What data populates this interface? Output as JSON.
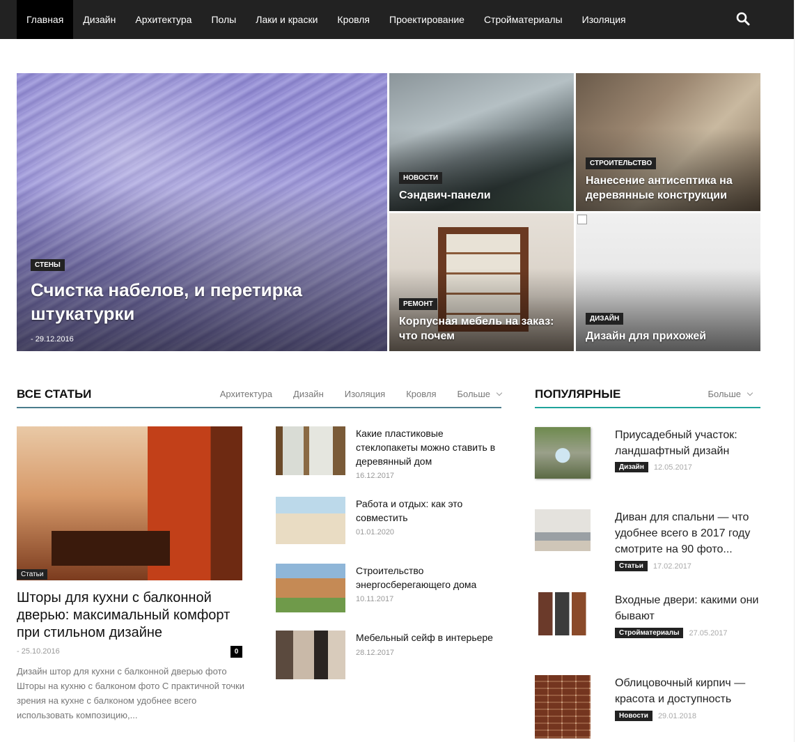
{
  "nav": {
    "items": [
      "Главная",
      "Дизайн",
      "Архитектура",
      "Полы",
      "Лаки и краски",
      "Кровля",
      "Проектирование",
      "Стройматериалы",
      "Изоляция"
    ],
    "search_icon": "search-icon"
  },
  "hero": {
    "main": {
      "category": "СТЕНЫ",
      "title": "Счистка набелов, и перетирка штукатурки",
      "date": "- 29.12.2016"
    },
    "a": {
      "category": "НОВОСТИ",
      "title": "Сэндвич-панели"
    },
    "b": {
      "category": "СТРОИТЕЛЬСТВО",
      "title": "Нанесение антисептика на деревянные конструкции"
    },
    "c": {
      "category": "РЕМОНТ",
      "title": "Корпусная мебель на заказ: что почем"
    },
    "d": {
      "category": "ДИЗАЙН",
      "title": "Дизайн для прихожей"
    }
  },
  "all_articles": {
    "title": "ВСЕ СТАТЬИ",
    "tabs": [
      "Архитектура",
      "Дизайн",
      "Изоляция",
      "Кровля",
      "Больше"
    ],
    "accent": "#4a7c8c",
    "big": {
      "category": "Статьи",
      "title": "Шторы для кухни с балконной дверью: максимальный комфорт при стильном дизайне",
      "date": "- 25.10.2016",
      "comments": "0",
      "excerpt": "Дизайн штор для кухни с балконной дверью фото Шторы на кухню с балконом фото С практичной точки зрения на кухне с балконом удобнее всего использовать композицию,..."
    },
    "items": [
      {
        "title": "Какие пластиковые стеклопакеты можно ставить в деревянный дом",
        "date": "16.12.2017"
      },
      {
        "title": "Работа и отдых: как это совместить",
        "date": "01.01.2020"
      },
      {
        "title": "Строительство энергосберегающего дома",
        "date": "10.11.2017"
      },
      {
        "title": "Мебельный сейф в интерьере",
        "date": "28.12.2017"
      }
    ]
  },
  "popular": {
    "title": "ПОПУЛЯРНЫЕ",
    "more": "Больше",
    "accent": "#1fa39b",
    "items": [
      {
        "title": "Приусадебный участок: ландшафтный дизайн",
        "category": "Дизайн",
        "date": "12.05.2017"
      },
      {
        "title": "Диван для спальни — что удобнее всего в 2017 году смотрите на 90 фото...",
        "category": "Статьи",
        "date": "17.02.2017"
      },
      {
        "title": "Входные двери: какими они бывают",
        "category": "Стройматериалы",
        "date": "27.05.2017"
      },
      {
        "title": "Облицовочный кирпич — красота и доступность",
        "category": "Новости",
        "date": "29.01.2018"
      }
    ]
  }
}
